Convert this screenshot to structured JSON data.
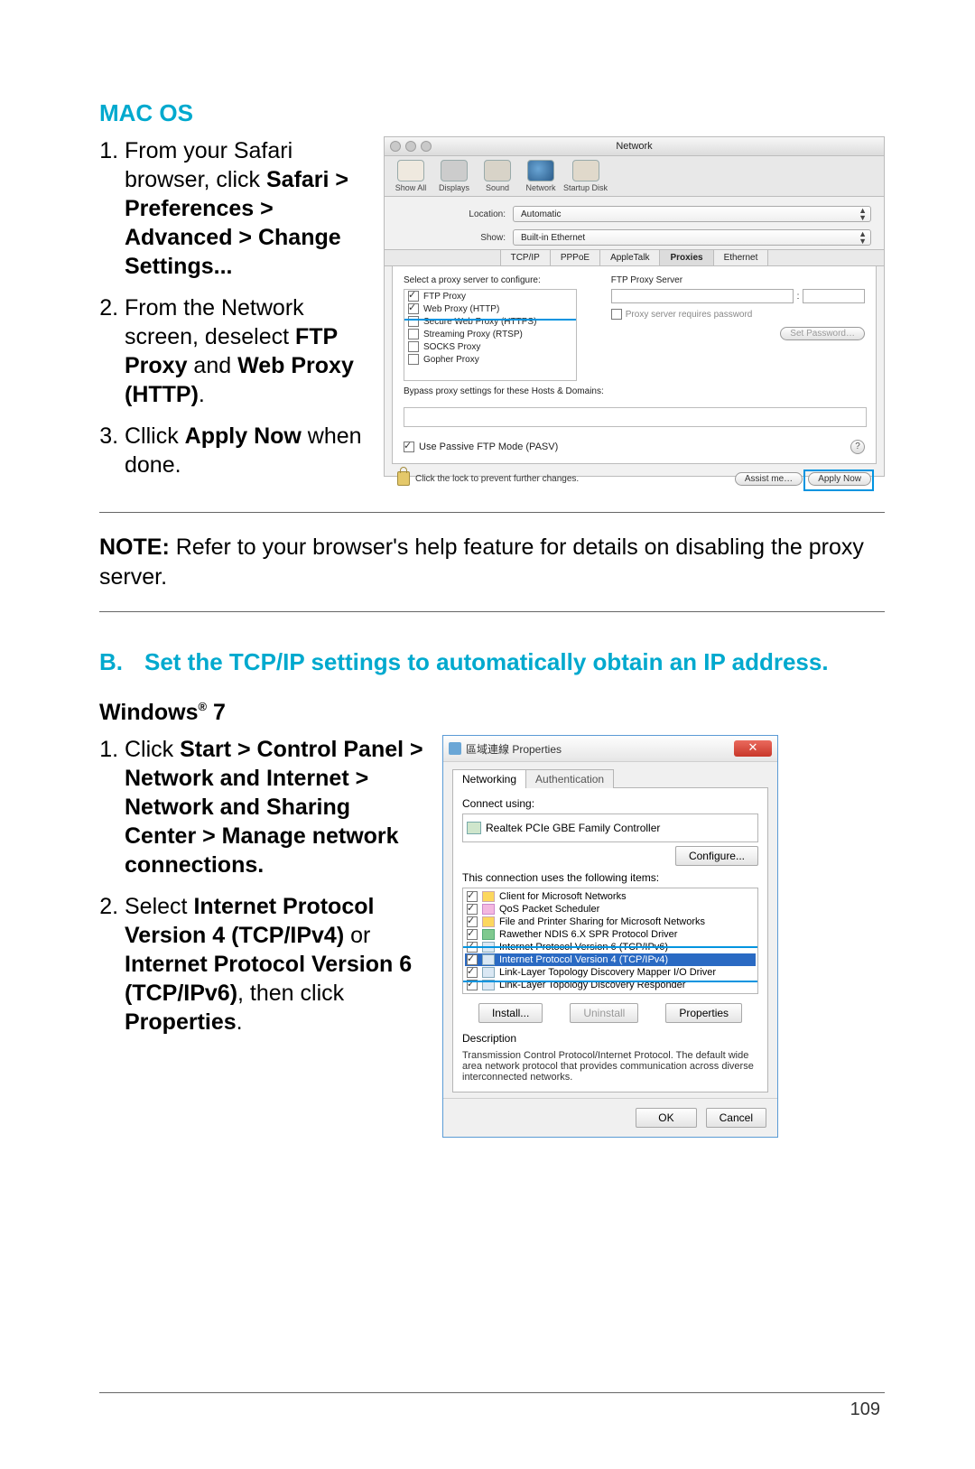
{
  "macos": {
    "heading": "MAC OS",
    "steps": [
      {
        "pre": "From your Safari browser, click ",
        "b": "Safari > Preferences > Advanced > Change Settings..."
      },
      {
        "pre": "From the Network screen, deselect ",
        "b": "FTP Proxy",
        "mid": " and ",
        "b2": "Web Proxy (HTTP)",
        "post": "."
      },
      {
        "pre": "Cllick ",
        "b": "Apply Now",
        "post": " when done."
      }
    ]
  },
  "mac_shot": {
    "title": "Network",
    "toolbar": [
      "Show All",
      "Displays",
      "Sound",
      "Network",
      "Startup Disk"
    ],
    "loc_label": "Location:",
    "loc_value": "Automatic",
    "show_label": "Show:",
    "show_value": "Built-in Ethernet",
    "tabs": [
      "TCP/IP",
      "PPPoE",
      "AppleTalk",
      "Proxies",
      "Ethernet"
    ],
    "cap_left": "Select a proxy server to configure:",
    "list": [
      {
        "c": true,
        "t": "FTP Proxy"
      },
      {
        "c": true,
        "t": "Web Proxy (HTTP)"
      },
      {
        "c": false,
        "t": "Secure Web Proxy (HTTPS)"
      },
      {
        "c": false,
        "t": "Streaming Proxy (RTSP)"
      },
      {
        "c": false,
        "t": "SOCKS Proxy"
      },
      {
        "c": false,
        "t": "Gopher Proxy"
      }
    ],
    "cap_right": "FTP Proxy Server",
    "pw_label": "Proxy server requires password",
    "setpw": "Set Password…",
    "bypass": "Bypass proxy settings for these Hosts & Domains:",
    "pasv": "Use Passive FTP Mode (PASV)",
    "lock": "Click the lock to prevent further changes.",
    "assist": "Assist me…",
    "apply": "Apply Now"
  },
  "note_label": "NOTE:",
  "note_text": " Refer to your browser's help feature for details on disabling the proxy server.",
  "sectionB": {
    "label": "B.",
    "title": "Set the TCP/IP settings to automatically obtain an IP address."
  },
  "win": {
    "heading": "Windows® 7",
    "step1": {
      "pre": "Click ",
      "b": "Start > Control Panel > Network and Internet > Network and Sharing Center > Manage network connections."
    },
    "step2": {
      "pre": "Select ",
      "b": "Internet Protocol Version 4 (TCP/IPv4)",
      "mid": " or ",
      "b2": "Internet Protocol Version 6 (TCP/IPv6)",
      "post": ", then click ",
      "b3": "Properties",
      "post2": "."
    }
  },
  "win_shot": {
    "title": "區域連線 Properties",
    "tabs": [
      "Networking",
      "Authentication"
    ],
    "connect_lab": "Connect using:",
    "adapter": "Realtek PCIe GBE Family Controller",
    "configure": "Configure...",
    "conn_cap": "This connection uses the following items:",
    "items": [
      {
        "ic": "y",
        "t": "Client for Microsoft Networks"
      },
      {
        "ic": "p",
        "t": "QoS Packet Scheduler"
      },
      {
        "ic": "y",
        "t": "File and Printer Sharing for Microsoft Networks"
      },
      {
        "ic": "g",
        "t": "Rawether NDIS 6.X SPR Protocol Driver"
      },
      {
        "ic": "n",
        "t": "Internet Protocol Version 6 (TCP/IPv6)"
      },
      {
        "ic": "n",
        "t": "Internet Protocol Version 4 (TCP/IPv4)",
        "sel": true
      },
      {
        "ic": "n",
        "t": "Link-Layer Topology Discovery Mapper I/O Driver"
      },
      {
        "ic": "n",
        "t": "Link-Layer Topology Discovery Responder"
      }
    ],
    "install": "Install...",
    "uninstall": "Uninstall",
    "props": "Properties",
    "desc_lab": "Description",
    "desc": "Transmission Control Protocol/Internet Protocol. The default wide area network protocol that provides communication across diverse interconnected networks.",
    "ok": "OK",
    "cancel": "Cancel",
    "close": "✕"
  },
  "page_number": "109"
}
